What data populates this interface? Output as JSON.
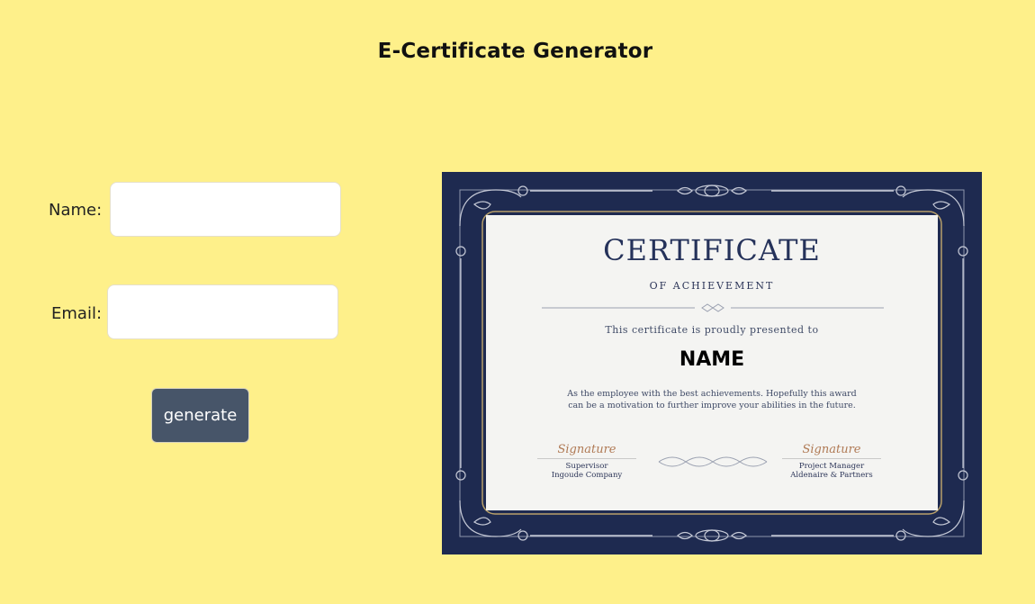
{
  "page": {
    "title": "E-Certificate Generator"
  },
  "form": {
    "name_label": "Name:",
    "name_value": "",
    "email_label": "Email:",
    "email_value": "",
    "generate_label": "generate"
  },
  "certificate": {
    "title": "CERTIFICATE",
    "subtitle": "OF ACHIEVEMENT",
    "presented_text": "This certificate is proudly presented to",
    "recipient_name": "NAME",
    "body_line1": "As the employee with the best achievements. Hopefully this award",
    "body_line2": "can be a motivation to further improve your abilities in the future.",
    "signatures": [
      {
        "script": "Signature",
        "role": "Supervisor",
        "org": "Ingoude Company"
      },
      {
        "script": "Signature",
        "role": "Project Manager",
        "org": "Aldenaire & Partners"
      }
    ]
  },
  "colors": {
    "background": "#fef08a",
    "button": "#475569",
    "certificate_border": "#1e2a50",
    "certificate_paper": "#f4f4f2",
    "gold_accent": "#b8a06a"
  }
}
